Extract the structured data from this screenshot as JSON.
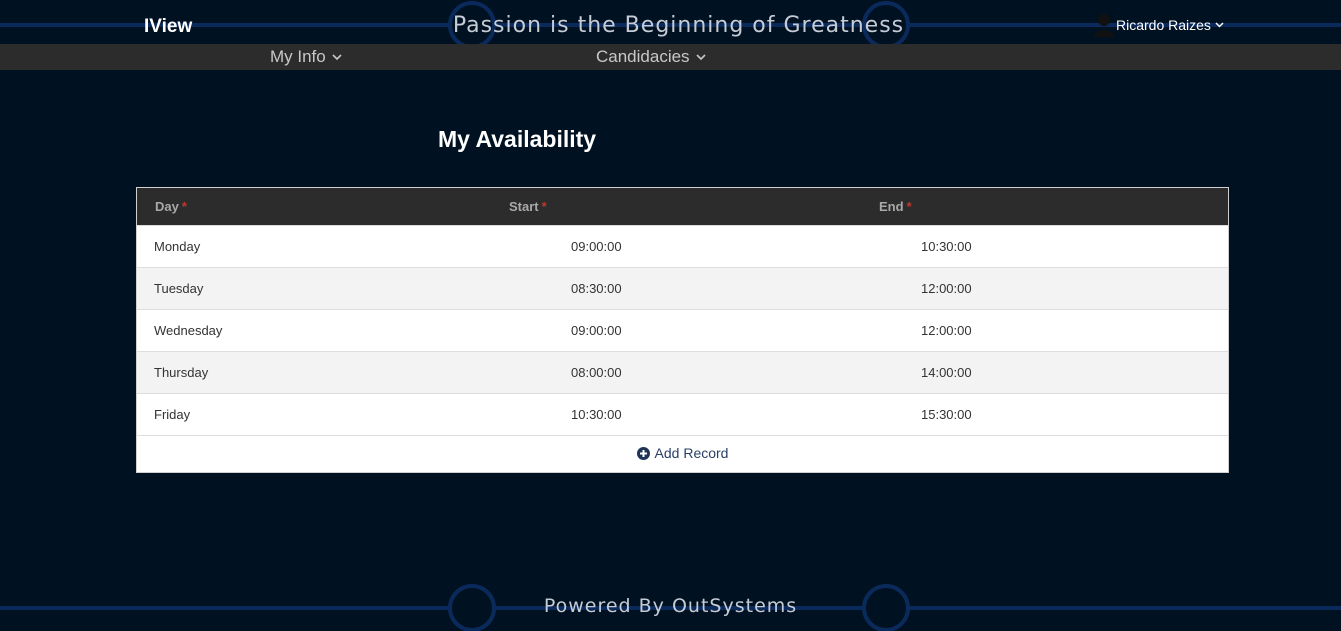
{
  "header": {
    "app_title": "IView",
    "tagline": "Passion is the Beginning of Greatness",
    "user_name": "Ricardo Raizes"
  },
  "menu": {
    "items": [
      {
        "label": "My Info"
      },
      {
        "label": "Candidacies"
      }
    ]
  },
  "main": {
    "title": "My Availability",
    "table": {
      "columns": [
        {
          "label": "Day",
          "required": "*"
        },
        {
          "label": "Start",
          "required": "*"
        },
        {
          "label": "End",
          "required": "*"
        }
      ],
      "rows": [
        {
          "day": "Monday",
          "start": "09:00:00",
          "end": "10:30:00"
        },
        {
          "day": "Tuesday",
          "start": "08:30:00",
          "end": "12:00:00"
        },
        {
          "day": "Wednesday",
          "start": "09:00:00",
          "end": "12:00:00"
        },
        {
          "day": "Thursday",
          "start": "08:00:00",
          "end": "14:00:00"
        },
        {
          "day": "Friday",
          "start": "10:30:00",
          "end": "15:30:00"
        }
      ],
      "add_record_label": "Add Record"
    }
  },
  "footer": {
    "text": "Powered By OutSystems"
  },
  "colors": {
    "background": "#001122",
    "menubar": "#2c2c2c",
    "required_star": "#c0392b",
    "link": "#2a3f66",
    "circuit": "#0b2a5c"
  },
  "icons": {
    "user": "user-silhouette-icon",
    "dropdown": "chevron-down-icon",
    "add": "plus-circle-icon"
  }
}
